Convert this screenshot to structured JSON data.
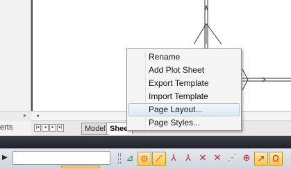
{
  "left_panel": {
    "label": "erts",
    "expand_icon": "triangle-right-icon"
  },
  "canvas": {
    "description_icon": "drawing-canvas"
  },
  "sheet_tabs": {
    "nav": [
      {
        "name": "first",
        "glyph": "|◂"
      },
      {
        "name": "prev",
        "glyph": "◂"
      },
      {
        "name": "next",
        "glyph": "▸"
      },
      {
        "name": "last",
        "glyph": "▸|"
      }
    ],
    "tabs": [
      {
        "label": "Model",
        "active": false
      },
      {
        "label": "Sheet",
        "active": true
      }
    ]
  },
  "context_menu": {
    "items": [
      {
        "label": "Rename",
        "highlighted": false
      },
      {
        "label": "Add Plot Sheet",
        "highlighted": false
      },
      {
        "label": "Export Template",
        "highlighted": false
      },
      {
        "label": "Import Template",
        "highlighted": false
      },
      {
        "label": "Page Layout...",
        "highlighted": true
      },
      {
        "label": "Page Styles...",
        "highlighted": false
      }
    ]
  },
  "toolbar": {
    "command_value": "",
    "play_icon": "▶",
    "tools": [
      {
        "name": "snap-grid-icon",
        "glyph": "⊿",
        "active": false,
        "color": "#2a7a2a"
      },
      {
        "name": "snap-center-icon",
        "glyph": "⊙",
        "active": true,
        "color": "#d9251d"
      },
      {
        "name": "snap-line-icon",
        "glyph": "⟋",
        "active": true,
        "color": "#d9251d"
      },
      {
        "name": "snap-tangent-icon",
        "glyph": "⅄",
        "active": false,
        "color": "#c02424"
      },
      {
        "name": "snap-perpendicular-icon",
        "glyph": "⅄",
        "active": false,
        "color": "#c02424"
      },
      {
        "name": "snap-intersection-icon",
        "glyph": "✕",
        "active": false,
        "color": "#c02424"
      },
      {
        "name": "snap-apparent-intersection-icon",
        "glyph": "✕",
        "active": false,
        "color": "#c02424"
      },
      {
        "name": "snap-extension-icon",
        "glyph": "⋰",
        "active": false,
        "color": "#c02424"
      },
      {
        "name": "snap-node-icon",
        "glyph": "⊕",
        "active": false,
        "color": "#c02424"
      },
      {
        "name": "snap-nearest-icon",
        "glyph": "↗",
        "active": true,
        "color": "#c02424"
      },
      {
        "name": "snap-quadrant-icon",
        "glyph": "Ω",
        "active": true,
        "color": "#c02424"
      }
    ]
  },
  "colors": {
    "dark_band": "#2a2d33",
    "menu_highlight": "#dde9f8",
    "tool_active": "#ffc649"
  }
}
